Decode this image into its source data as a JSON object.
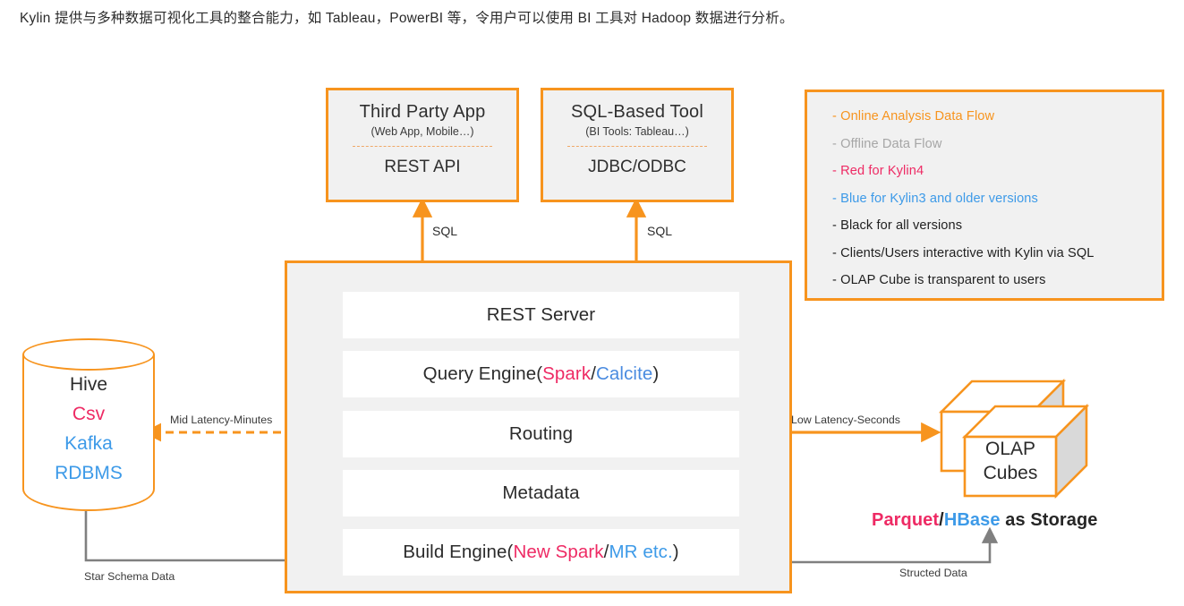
{
  "intro": {
    "text": "Kylin 提供与多种数据可视化工具的整合能力，如 Tableau，PowerBI 等，令用户可以使用 BI 工具对 Hadoop 数据进行分析。"
  },
  "colors": {
    "orange": "#F7941E",
    "gray_arrow": "#808080",
    "pink": "#EE2A64",
    "blue": "#3D9AE8",
    "calcite_blue": "#4A8BE0",
    "panel_bg": "#F1F1F1",
    "box_bg": "#FFFFFF",
    "legend_gray_text": "#A6A6A6"
  },
  "clients": [
    {
      "title": "Third Party App",
      "subtitle": "(Web App, Mobile…)",
      "api": "REST API",
      "connector_label": "SQL"
    },
    {
      "title": "SQL-Based Tool",
      "subtitle": "(BI Tools: Tableau…)",
      "api": "JDBC/ODBC",
      "connector_label": "SQL"
    }
  ],
  "legend": {
    "rows": [
      {
        "label": "- Online Analysis Data Flow",
        "color_key": "orange",
        "arrow": "orange-double-arrow"
      },
      {
        "label": "- Offline Data Flow",
        "color_key": "gray",
        "arrow": "gray-double-arrow"
      },
      {
        "label": "- Red for Kylin4",
        "color_key": "pink",
        "arrow": ""
      },
      {
        "label": "- Blue for Kylin3 and older versions",
        "color_key": "blue",
        "arrow": ""
      },
      {
        "label": "- Black for all versions",
        "color_key": "black",
        "arrow": ""
      },
      {
        "label": "- Clients/Users interactive with Kylin via SQL",
        "color_key": "black",
        "arrow": ""
      },
      {
        "label": "- OLAP Cube is transparent to users",
        "color_key": "black",
        "arrow": ""
      }
    ]
  },
  "kylin_layers": [
    {
      "name": "rest-server",
      "parts": [
        {
          "text": "REST Server",
          "color": "black"
        }
      ]
    },
    {
      "name": "query-engine",
      "parts": [
        {
          "text": "Query Engine(",
          "color": "black"
        },
        {
          "text": "Spark",
          "color": "pink"
        },
        {
          "text": "/",
          "color": "black"
        },
        {
          "text": "Calcite",
          "color": "calcite_blue"
        },
        {
          "text": ")",
          "color": "black"
        }
      ]
    },
    {
      "name": "routing",
      "parts": [
        {
          "text": "Routing",
          "color": "black"
        }
      ]
    },
    {
      "name": "metadata",
      "parts": [
        {
          "text": "Metadata",
          "color": "black"
        }
      ]
    },
    {
      "name": "build-engine",
      "parts": [
        {
          "text": "Build Engine(",
          "color": "black"
        },
        {
          "text": "New Spark",
          "color": "pink"
        },
        {
          "text": "/",
          "color": "black"
        },
        {
          "text": "MR etc.",
          "color": "blue"
        },
        {
          "text": ")",
          "color": "black"
        }
      ]
    }
  ],
  "datasource": {
    "lines": [
      {
        "text": "Hive",
        "color": "black"
      },
      {
        "text": "Csv",
        "color": "pink"
      },
      {
        "text": "Kafka",
        "color": "blue"
      },
      {
        "text": "RDBMS",
        "color": "blue"
      }
    ]
  },
  "storage": {
    "cube_label_line1": "OLAP",
    "cube_label_line2": "Cubes",
    "storage_parts": [
      {
        "text": "Parquet",
        "color": "pink"
      },
      {
        "text": "/",
        "color": "black"
      },
      {
        "text": "HBase",
        "color": "blue"
      },
      {
        "text": " as Storage",
        "color": "black"
      }
    ]
  },
  "edge_labels": {
    "mid_latency": "Mid Latency-Minutes",
    "low_latency": "Low Latency-Seconds",
    "star_schema": "Star Schema Data",
    "structed_data": "Structed Data"
  }
}
